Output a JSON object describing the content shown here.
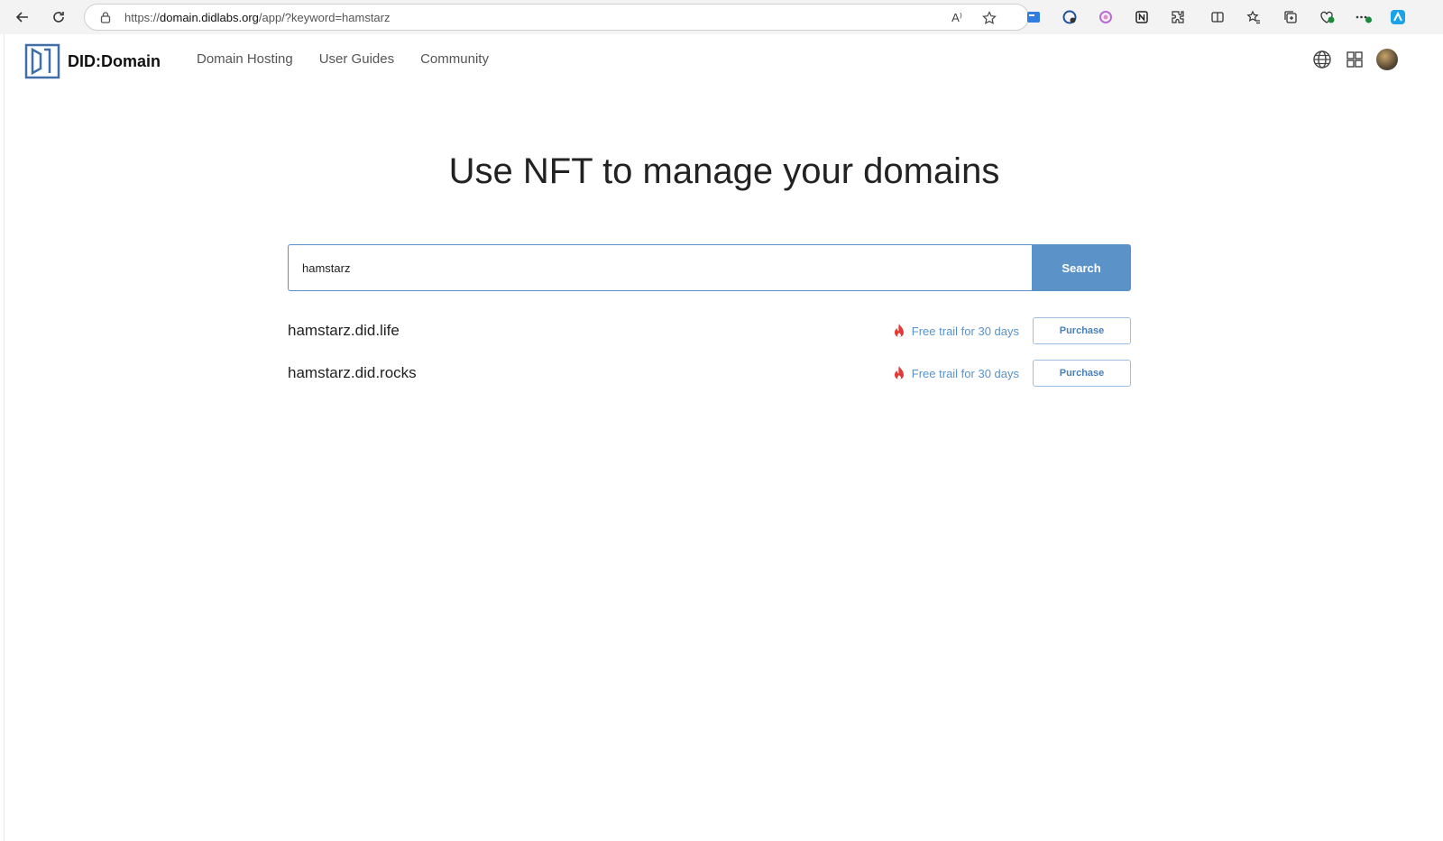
{
  "browser": {
    "url_prefix": "https://",
    "url_host": "domain.didlabs.org",
    "url_path": "/app/?keyword=hamstarz",
    "read_aloud_label": "A⁾"
  },
  "site": {
    "logo_text": "DID:Domain",
    "nav": [
      "Domain Hosting",
      "User Guides",
      "Community"
    ]
  },
  "hero": {
    "title": "Use NFT to manage your domains"
  },
  "search": {
    "value": "hamstarz",
    "button_label": "Search"
  },
  "results": [
    {
      "domain": "hamstarz.did.life",
      "trial_text": "Free trail for 30 days",
      "button_label": "Purchase"
    },
    {
      "domain": "hamstarz.did.rocks",
      "trial_text": "Free trail for 30 days",
      "button_label": "Purchase"
    }
  ],
  "colors": {
    "accent": "#5b93c9",
    "fire": "#e53935"
  }
}
